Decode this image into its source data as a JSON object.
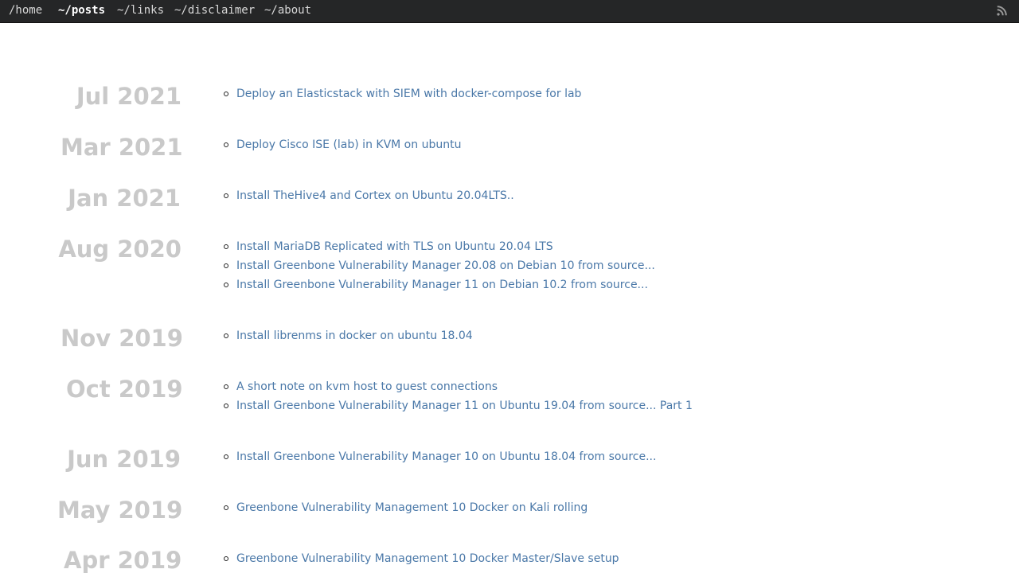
{
  "nav": {
    "home": "/home",
    "posts": "~/posts",
    "links": "~/links",
    "disclaimer": "~/disclaimer",
    "about": "~/about"
  },
  "icons": {
    "rss": "rss-icon"
  },
  "colors": {
    "topbar_bg": "#252627",
    "year_text": "#c9c9c9",
    "post_link": "#4a78a8"
  },
  "archive": {
    "groups": [
      {
        "date": "Jul 2021",
        "posts": [
          "Deploy an Elasticstack with SIEM with docker-compose for lab"
        ]
      },
      {
        "date": "Mar 2021",
        "posts": [
          "Deploy Cisco ISE (lab) in KVM on ubuntu"
        ]
      },
      {
        "date": "Jan 2021",
        "posts": [
          "Install TheHive4 and Cortex on Ubuntu 20.04LTS.."
        ]
      },
      {
        "date": "Aug 2020",
        "posts": [
          "Install MariaDB Replicated with TLS on Ubuntu 20.04 LTS",
          "Install Greenbone Vulnerability Manager 20.08 on Debian 10 from source...",
          "Install Greenbone Vulnerability Manager 11 on Debian 10.2 from source..."
        ]
      },
      {
        "date": "Nov 2019",
        "posts": [
          "Install librenms in docker on ubuntu 18.04"
        ]
      },
      {
        "date": "Oct 2019",
        "posts": [
          "A short note on kvm host to guest connections",
          "Install Greenbone Vulnerability Manager 11 on Ubuntu 19.04 from source... Part 1"
        ]
      },
      {
        "date": "Jun 2019",
        "posts": [
          "Install Greenbone Vulnerability Manager 10 on Ubuntu 18.04 from source..."
        ]
      },
      {
        "date": "May 2019",
        "posts": [
          "Greenbone Vulnerability Management 10 Docker on Kali rolling"
        ]
      },
      {
        "date": "Apr 2019",
        "posts": [
          "Greenbone Vulnerability Management 10 Docker Master/Slave setup"
        ]
      }
    ]
  }
}
